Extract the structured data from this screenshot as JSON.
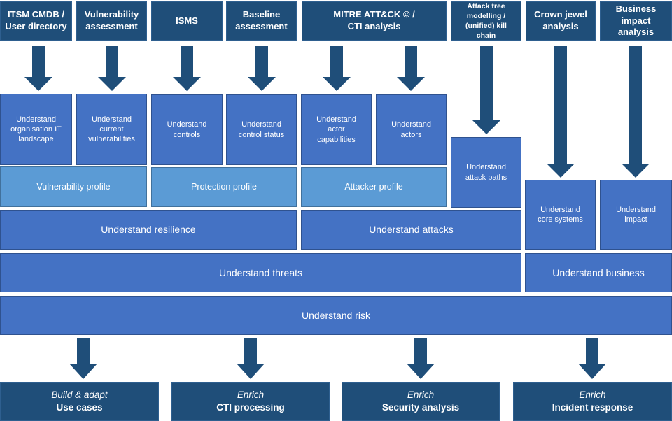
{
  "colors": {
    "source_box": "#1f4e79",
    "understand_box": "#4472c4",
    "profile_box": "#5b9bd5",
    "arrow": "#1f4e79",
    "text": "#ffffff"
  },
  "sources": [
    {
      "label": "ITSM CMDB / User directory"
    },
    {
      "label": "Vulnerability assessment"
    },
    {
      "label": "ISMS"
    },
    {
      "label": "Baseline assessment"
    },
    {
      "label": "MITRE ATT&CK © / CTI analysis"
    },
    {
      "label": "Attack tree modelling / (unified) kill chain"
    },
    {
      "label": "Crown jewel analysis"
    },
    {
      "label": "Business impact analysis"
    }
  ],
  "understand": [
    {
      "label": "Understand organisation IT landscape"
    },
    {
      "label": "Understand current vulnerabilities"
    },
    {
      "label": "Understand controls"
    },
    {
      "label": "Understand control status"
    },
    {
      "label": "Understand actor capabilities"
    },
    {
      "label": "Understand actors"
    },
    {
      "label": "Understand attack paths"
    },
    {
      "label": "Understand core systems"
    },
    {
      "label": "Understand impact"
    }
  ],
  "profiles": [
    {
      "label": "Vulnerability profile"
    },
    {
      "label": "Protection profile"
    },
    {
      "label": "Attacker profile"
    }
  ],
  "aggregates": {
    "resilience": "Understand resilience",
    "attacks": "Understand attacks",
    "threats": "Understand threats",
    "business": "Understand business",
    "risk": "Understand risk"
  },
  "outputs": [
    {
      "verb": "Build & adapt",
      "label": "Use cases"
    },
    {
      "verb": "Enrich",
      "label": "CTI processing"
    },
    {
      "verb": "Enrich",
      "label": "Security analysis"
    },
    {
      "verb": "Enrich",
      "label": "Incident response"
    }
  ]
}
